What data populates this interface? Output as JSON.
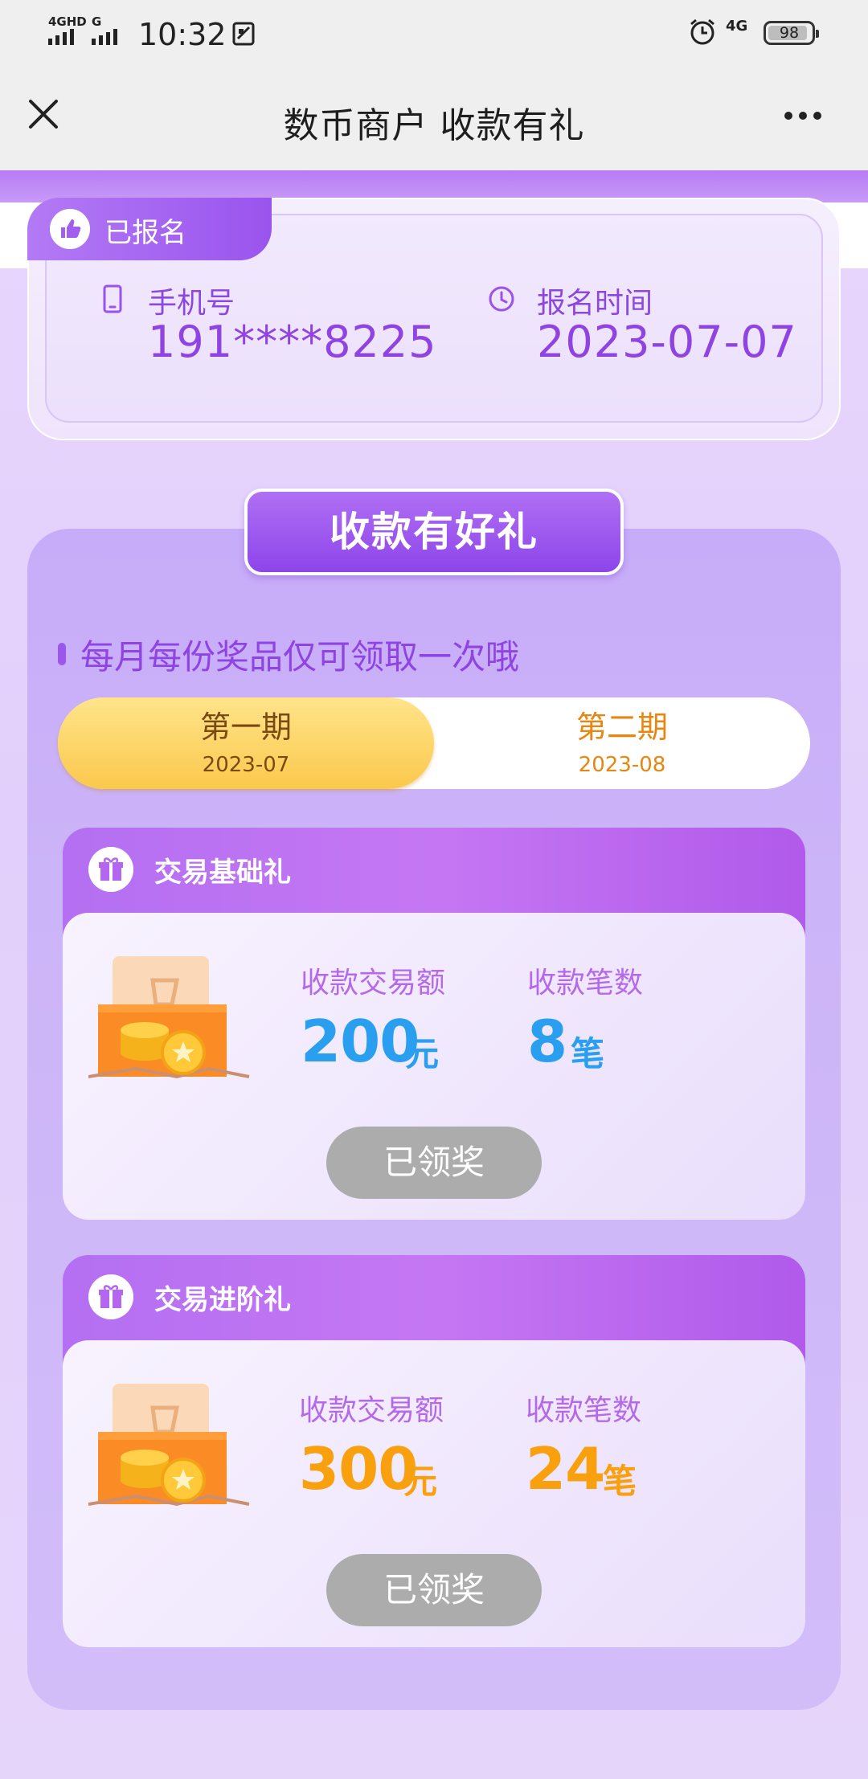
{
  "status_bar": {
    "signal_1_label": "4GHD",
    "signal_2_label": "G",
    "time": "10:32",
    "network": "4G",
    "battery": "98"
  },
  "header": {
    "title": "数币商户 收款有礼"
  },
  "registration": {
    "badge": "已报名",
    "phone_label": "手机号",
    "phone_value": "191****8225",
    "time_label": "报名时间",
    "time_value": "2023-07-07"
  },
  "main": {
    "title": "收款有好礼",
    "notice": "每月每份奖品仅可领取一次哦",
    "tabs": [
      {
        "name": "第一期",
        "date": "2023-07",
        "active": true
      },
      {
        "name": "第二期",
        "date": "2023-08",
        "active": false
      }
    ],
    "gifts": [
      {
        "title": "交易基础礼",
        "amount_label": "收款交易额",
        "amount_value": "200",
        "amount_unit": "元",
        "count_label": "收款笔数",
        "count_value": "8",
        "count_unit": "笔",
        "button": "已领奖",
        "value_color": "#2a9fef"
      },
      {
        "title": "交易进阶礼",
        "amount_label": "收款交易额",
        "amount_value": "300",
        "amount_unit": "元",
        "count_label": "收款笔数",
        "count_value": "24",
        "count_unit": "笔",
        "button": "已领奖",
        "value_color": "#f8a00e"
      }
    ]
  },
  "icons": {
    "close": "close-icon",
    "more": "more-icon",
    "thumbs_up": "thumbs-up-icon",
    "phone": "phone-icon",
    "clock": "clock-icon",
    "gift": "gift-icon"
  }
}
